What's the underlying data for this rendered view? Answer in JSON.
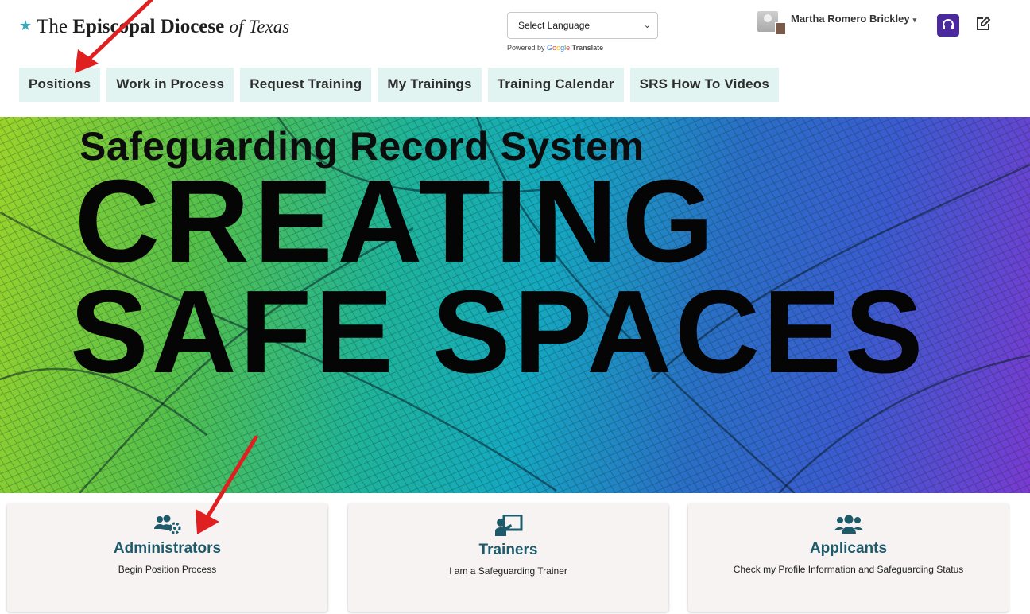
{
  "header": {
    "logo": {
      "prefix": "The",
      "name": "Episcopal Diocese",
      "of": "of",
      "place": "Texas"
    },
    "language_select": {
      "value": "Select Language",
      "powered_by": "Powered by",
      "google_letters": [
        "G",
        "o",
        "o",
        "g",
        "l",
        "e"
      ],
      "translate": "Translate"
    },
    "user": {
      "name": "Martha Romero Brickley"
    },
    "icons": {
      "help": "headset-icon",
      "edit": "edit-icon"
    }
  },
  "nav": {
    "tabs": [
      {
        "label": "Positions"
      },
      {
        "label": "Work in Process"
      },
      {
        "label": "Request Training"
      },
      {
        "label": "My Trainings"
      },
      {
        "label": "Training Calendar"
      },
      {
        "label": "SRS How To Videos"
      }
    ]
  },
  "hero": {
    "subtitle": "Safeguarding Record System",
    "line1": "CREATING",
    "line2": "SAFE SPACES"
  },
  "cards": [
    {
      "title": "Administrators",
      "description": "Begin Position Process",
      "icon": "users-cog-icon"
    },
    {
      "title": "Trainers",
      "description": "I am a Safeguarding Trainer",
      "icon": "chalkboard-teacher-icon"
    },
    {
      "title": "Applicants",
      "description": "Check my Profile Information and Safeguarding Status",
      "icon": "users-icon"
    }
  ],
  "colors": {
    "accent": "#1d5b6b",
    "tab_bg": "#e2f4f1",
    "help_button": "#4a2a9c",
    "arrow": "#e02020"
  }
}
